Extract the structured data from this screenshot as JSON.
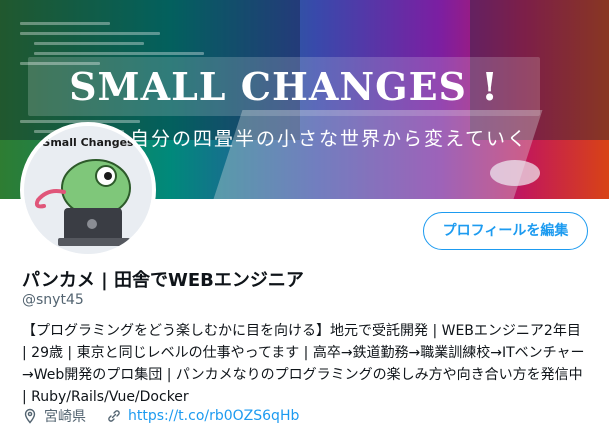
{
  "banner": {
    "title": "SMALL CHANGES !",
    "subtitle": "自分の四畳半の小さな世界から変えていく"
  },
  "avatar": {
    "caption": "Small Changes"
  },
  "actions": {
    "edit_profile_label": "プロフィールを編集"
  },
  "profile": {
    "display_name": "パンカメ | 田舎でWEBエンジニア",
    "handle": "@snyt45",
    "bio": "【プログラミングをどう楽しむかに目を向ける】地元で受託開発 | WEBエンジニア2年目 | 29歳 | 東京と同じレベルの仕事やってます | 高卒→鉄道勤務→職業訓練校→ITベンチャー→Web開発のプロ集団 | パンカメなりのプログラミングの楽しみ方や向き合い方を発信中 | Ruby/Rails/Vue/Docker",
    "location": "宮崎県",
    "website": "https://t.co/rb0OZS6qHb"
  },
  "icons": {
    "location": "location-pin-icon",
    "link": "link-icon"
  },
  "colors": {
    "accent": "#1d9bf0",
    "secondary_text": "#536471",
    "primary_text": "#0f1419"
  }
}
